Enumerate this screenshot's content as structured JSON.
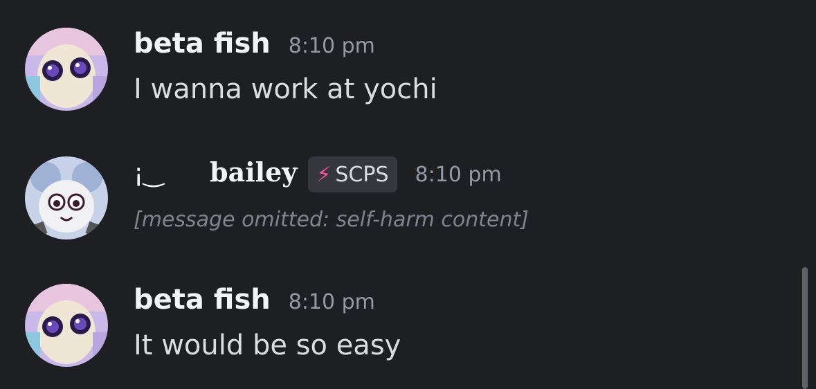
{
  "messages": [
    {
      "author": "beta fish",
      "time": "8:10 pm",
      "text": "I wanna work at yochi"
    },
    {
      "author": "bailey",
      "prefix": "¡‿",
      "tag": {
        "label": "SCPS",
        "icon": "lightning-icon",
        "icon_glyph": "⚡"
      },
      "time": "8:10 pm",
      "text": "[message omitted: self-harm content]"
    },
    {
      "author": "beta fish",
      "time": "8:10 pm",
      "text": "It would be so easy"
    }
  ],
  "colors": {
    "background": "#1e1f22",
    "author": "#f2f3f5",
    "timestamp": "#949ba4",
    "message": "#dbdee1",
    "tag_bg": "#35373c",
    "tag_icon": "#ff4fa3"
  }
}
